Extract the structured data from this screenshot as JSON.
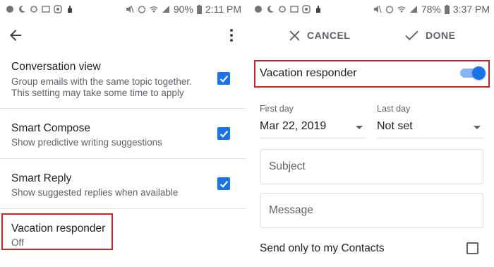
{
  "left": {
    "status": {
      "battery": "90%",
      "time": "2:11 PM"
    },
    "settings": [
      {
        "title": "Conversation view",
        "desc1": "Group emails with the same topic together.",
        "desc2": "This setting may take some time to apply"
      },
      {
        "title": "Smart Compose",
        "desc1": "Show predictive writing suggestions"
      },
      {
        "title": "Smart Reply",
        "desc1": "Show suggested replies when available"
      },
      {
        "title": "Vacation responder",
        "desc1": "Off"
      }
    ]
  },
  "right": {
    "status": {
      "battery": "78%",
      "time": "3:37 PM"
    },
    "cancel_label": "CANCEL",
    "done_label": "DONE",
    "vacation_label": "Vacation responder",
    "first_day_label": "First day",
    "first_day_value": "Mar 22, 2019",
    "last_day_label": "Last day",
    "last_day_value": "Not set",
    "subject_placeholder": "Subject",
    "message_placeholder": "Message",
    "contacts_label": "Send only to my Contacts"
  },
  "colors": {
    "accent": "#1a73e8",
    "highlight": "#c62828"
  },
  "icons": [
    "back-arrow-icon",
    "more-vert-icon",
    "close-icon",
    "check-icon",
    "wifi-icon",
    "signal-icon",
    "alarm-icon",
    "battery-icon"
  ]
}
